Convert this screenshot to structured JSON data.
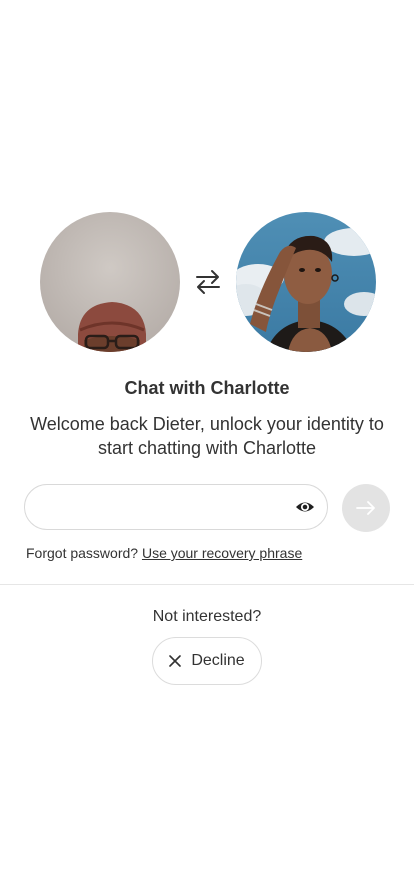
{
  "colors": {
    "text": "#333333",
    "submit_button_bg": "#e3e3e3",
    "submit_arrow": "#ffffff",
    "border": "#d9d9d9",
    "divider": "#e6e6e6"
  },
  "avatars": {
    "left_icon": "user-photo",
    "swap_icon": "swap-arrows-icon",
    "right_icon": "contact-photo"
  },
  "header": {
    "title": "Chat with Charlotte",
    "subtitle": "Welcome back Dieter, unlock your identity to start chatting with Charlotte"
  },
  "password": {
    "value": "",
    "placeholder": "",
    "visibility_icon": "eye-icon",
    "submit_icon": "arrow-right-icon"
  },
  "forgot": {
    "prefix": "Forgot password?",
    "link": "Use your recovery phrase"
  },
  "decline_section": {
    "prompt": "Not interested?",
    "button_label": "Decline",
    "button_icon": "close-icon"
  }
}
